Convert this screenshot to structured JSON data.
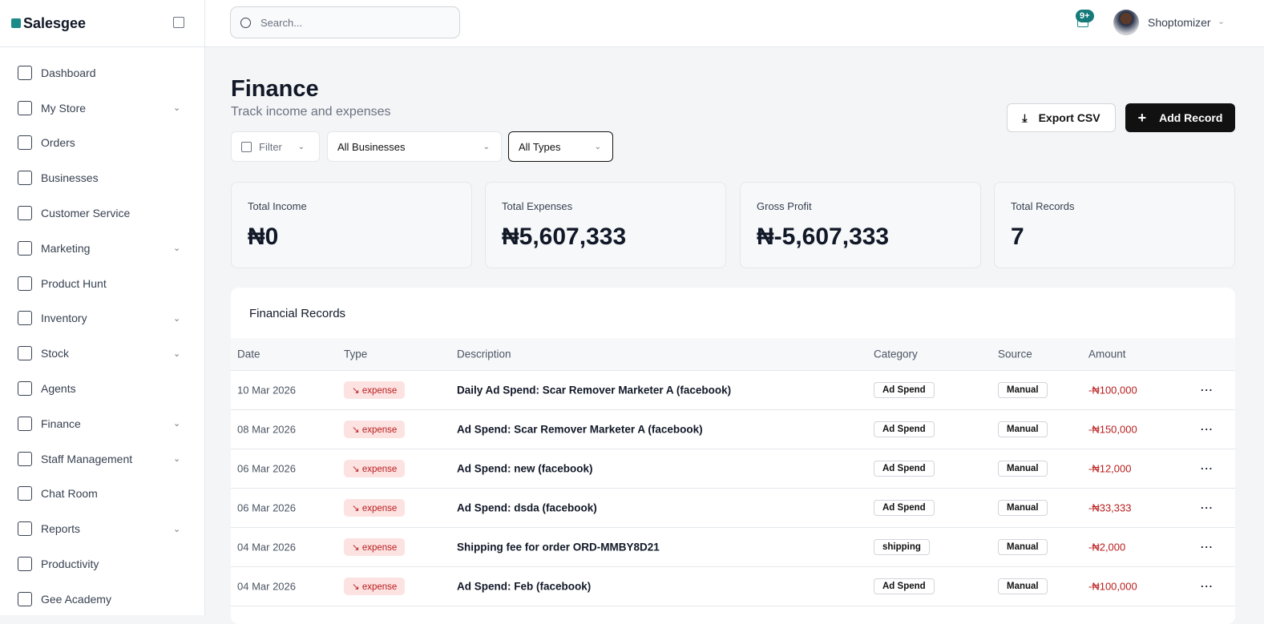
{
  "app": {
    "name": "Salesgee"
  },
  "sidebar": {
    "items": [
      {
        "label": "Dashboard",
        "icon": "grid-icon",
        "chevron": false
      },
      {
        "label": "My Store",
        "icon": "store-icon",
        "chevron": true
      },
      {
        "label": "Orders",
        "icon": "cart-icon",
        "chevron": false
      },
      {
        "label": "Businesses",
        "icon": "briefcase-icon",
        "chevron": false
      },
      {
        "label": "Customer Service",
        "icon": "users-icon",
        "chevron": false
      },
      {
        "label": "Marketing",
        "icon": "megaphone-icon",
        "chevron": true
      },
      {
        "label": "Product Hunt",
        "icon": "box-icon",
        "chevron": false
      },
      {
        "label": "Inventory",
        "icon": "building-icon",
        "chevron": true
      },
      {
        "label": "Stock",
        "icon": "boxes-icon",
        "chevron": true
      },
      {
        "label": "Agents",
        "icon": "users-icon",
        "chevron": false
      },
      {
        "label": "Finance",
        "icon": "wallet-icon",
        "chevron": true
      },
      {
        "label": "Staff Management",
        "icon": "user-cog-icon",
        "chevron": true
      },
      {
        "label": "Chat Room",
        "icon": "chat-icon",
        "chevron": false
      },
      {
        "label": "Reports",
        "icon": "report-icon",
        "chevron": true
      },
      {
        "label": "Productivity",
        "icon": "wrench-icon",
        "chevron": false
      },
      {
        "label": "Gee Academy",
        "icon": "graduation-cap-icon",
        "chevron": false
      }
    ]
  },
  "topbar": {
    "search_placeholder": "Search...",
    "notifications": "9+",
    "user": "Shoptomizer"
  },
  "page": {
    "title": "Finance",
    "subtitle": "Track income and expenses",
    "export": "Export CSV",
    "add": "Add Record"
  },
  "filters": {
    "filter": "Filter",
    "business": "All Businesses",
    "type": "All Types"
  },
  "stats": [
    {
      "label": "Total Income",
      "value": "₦0"
    },
    {
      "label": "Total Expenses",
      "value": "₦5,607,333"
    },
    {
      "label": "Gross Profit",
      "value": "₦-5,607,333"
    },
    {
      "label": "Total Records",
      "value": "7"
    }
  ],
  "table": {
    "title": "Financial Records",
    "columns": [
      "Date",
      "Type",
      "Description",
      "Category",
      "Source",
      "Amount"
    ],
    "rows": [
      {
        "date": "10 Mar 2026",
        "type": "expense",
        "description": "Daily Ad Spend: Scar Remover Marketer A (facebook)",
        "category": "Ad Spend",
        "source": "Manual",
        "amount": "-₦100,000"
      },
      {
        "date": "08 Mar 2026",
        "type": "expense",
        "description": "Ad Spend: Scar Remover Marketer A (facebook)",
        "category": "Ad Spend",
        "source": "Manual",
        "amount": "-₦150,000"
      },
      {
        "date": "06 Mar 2026",
        "type": "expense",
        "description": "Ad Spend: new (facebook)",
        "category": "Ad Spend",
        "source": "Manual",
        "amount": "-₦12,000"
      },
      {
        "date": "06 Mar 2026",
        "type": "expense",
        "description": "Ad Spend: dsda (facebook)",
        "category": "Ad Spend",
        "source": "Manual",
        "amount": "-₦33,333"
      },
      {
        "date": "04 Mar 2026",
        "type": "expense",
        "description": "Shipping fee for order ORD-MMBY8D21",
        "category": "shipping",
        "source": "Manual",
        "amount": "-₦2,000"
      },
      {
        "date": "04 Mar 2026",
        "type": "expense",
        "description": "Ad Spend: Feb (facebook)",
        "category": "Ad Spend",
        "source": "Manual",
        "amount": "-₦100,000"
      }
    ]
  }
}
